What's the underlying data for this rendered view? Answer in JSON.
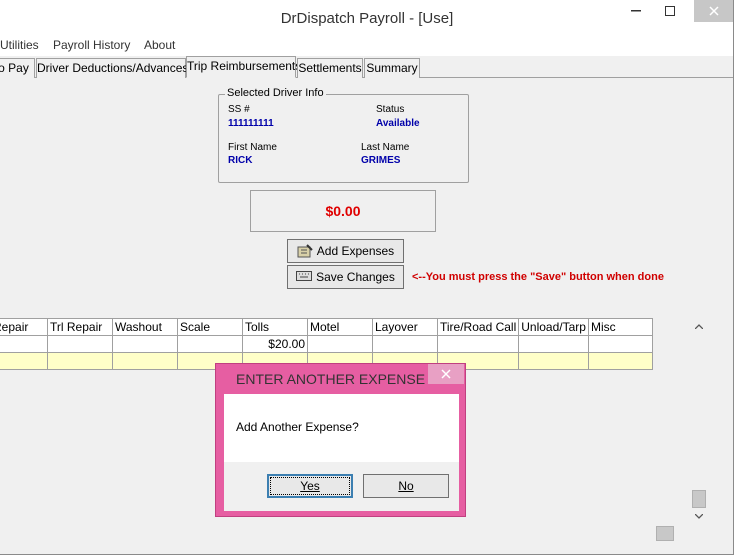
{
  "window": {
    "title": "DrDispatch Payroll - [Use]"
  },
  "menu": [
    "Utilities",
    "Payroll History",
    "About"
  ],
  "tabs": [
    {
      "label": "To Pay"
    },
    {
      "label": "Driver Deductions/Advances"
    },
    {
      "label": "Trip Reimbursements"
    },
    {
      "label": "Settlements"
    },
    {
      "label": "Summary"
    }
  ],
  "driver_info": {
    "legend": "Selected Driver Info",
    "ssn_label": "SS #",
    "ssn_value": "111111111",
    "status_label": "Status",
    "status_value": "Available",
    "first_name_label": "First Name",
    "first_name_value": "RICK",
    "last_name_label": "Last Name",
    "last_name_value": "GRIMES"
  },
  "total": "$0.00",
  "buttons": {
    "add_expenses": "Add Expenses",
    "save_changes": "Save Changes"
  },
  "notice": "<--You must press the \"Save\" button when done",
  "grid": {
    "columns": [
      "Repair",
      "Trl Repair",
      "Washout",
      "Scale",
      "Tolls",
      "Motel",
      "Layover",
      "Tire/Road Call",
      "Unload/Tarp",
      "Misc"
    ],
    "rows": [
      [
        "",
        "",
        "",
        "",
        "$20.00",
        "",
        "",
        "",
        "",
        ""
      ],
      [
        "",
        "",
        "",
        "",
        "",
        "",
        "",
        "",
        "",
        ""
      ]
    ]
  },
  "dialog": {
    "title": "ENTER ANOTHER EXPENSE",
    "message": "Add Another Expense?",
    "yes": "Yes",
    "no": "No"
  },
  "colors": {
    "dialog_frame": "#e65ea2",
    "total_text": "#e00000",
    "value_text": "#0000aa",
    "notice_text": "#d00000",
    "row_highlight": "#ffffc8"
  }
}
